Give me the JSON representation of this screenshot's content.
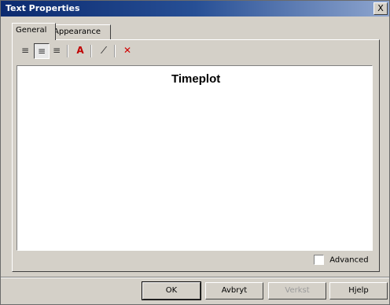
{
  "window": {
    "title": "Text Properties",
    "close_label": "X"
  },
  "tabs": [
    {
      "label": "General"
    },
    {
      "label": "Appearance"
    }
  ],
  "editor": {
    "content": "Timeplot"
  },
  "options": {
    "advanced_label": "Advanced",
    "advanced_checked": false
  },
  "buttons": {
    "ok": "OK",
    "apply": "Avbryt",
    "cancel": "Verkst",
    "help": "Hjelp"
  },
  "colors": {
    "title_bar": "#0b2a6f",
    "delete_icon": "#d00000",
    "font_color_icon": "#c00000"
  }
}
